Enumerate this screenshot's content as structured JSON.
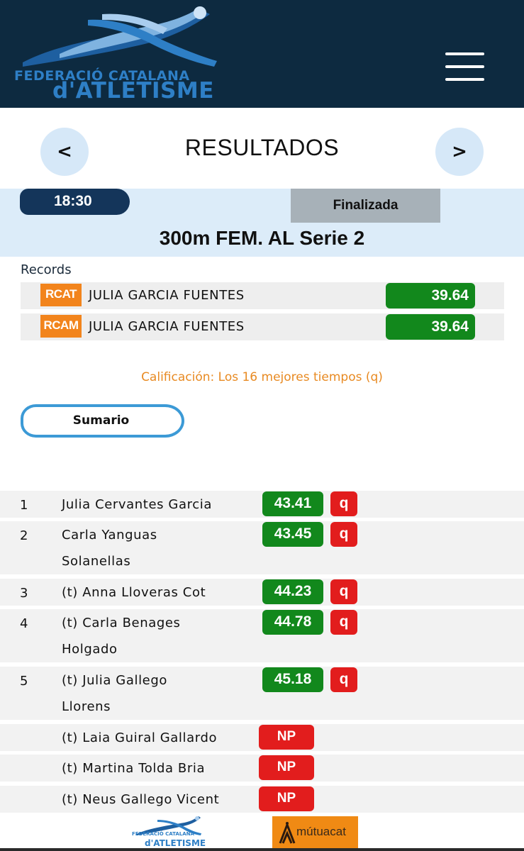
{
  "header": {
    "logo_line1": "FEDERACIÓ CATALANA",
    "logo_line2": "d'ATLETISME",
    "menu_icon": "hamburger-menu-icon",
    "background_color": "#0d2a40"
  },
  "nav": {
    "title": "RESULTADOS",
    "prev_label": "<",
    "next_label": ">"
  },
  "event": {
    "time": "18:30",
    "status": "Finalizada",
    "name": "300m FEM. AL Serie 2"
  },
  "records": {
    "label": "Records",
    "items": [
      {
        "type": "RCAT",
        "athlete": "JULIA GARCIA FUENTES",
        "time": "39.64"
      },
      {
        "type": "RCAM",
        "athlete": "JULIA GARCIA FUENTES",
        "time": "39.64"
      }
    ]
  },
  "qualification": "Calificación: Los 16 mejores tiempos (q)",
  "summary_button": "Sumario",
  "results": [
    {
      "pos": "1",
      "name": "Julia Cervantes Garcia",
      "time": "43.41",
      "q": "q"
    },
    {
      "pos": "2",
      "name": "Carla Yanguas Solanellas",
      "time": "43.45",
      "q": "q"
    },
    {
      "pos": "3",
      "name": "(t) Anna Lloveras Cot",
      "time": "44.23",
      "q": "q"
    },
    {
      "pos": "4",
      "name": "(t) Carla Benages Holgado",
      "time": "44.78",
      "q": "q"
    },
    {
      "pos": "5",
      "name": "(t) Julia Gallego Llorens",
      "time": "45.18",
      "q": "q"
    },
    {
      "pos": "",
      "name": "(t) Laia Guiral Gallardo",
      "status": "NP"
    },
    {
      "pos": "",
      "name": "(t) Martina Tolda Bria",
      "status": "NP"
    },
    {
      "pos": "",
      "name": "(t) Neus Gallego Vicent",
      "status": "NP"
    }
  ],
  "footer": {
    "logo_line1": "FEDERACIÓ CATALANA",
    "logo_line2": "d'ATLETISME",
    "sponsor": "mútuacat"
  },
  "colors": {
    "accent_blue": "#2e7fc6",
    "time_green": "#12881c",
    "qualified_red": "#e21d1d",
    "record_orange": "#f2841c",
    "qualification_text": "#e88a22"
  }
}
